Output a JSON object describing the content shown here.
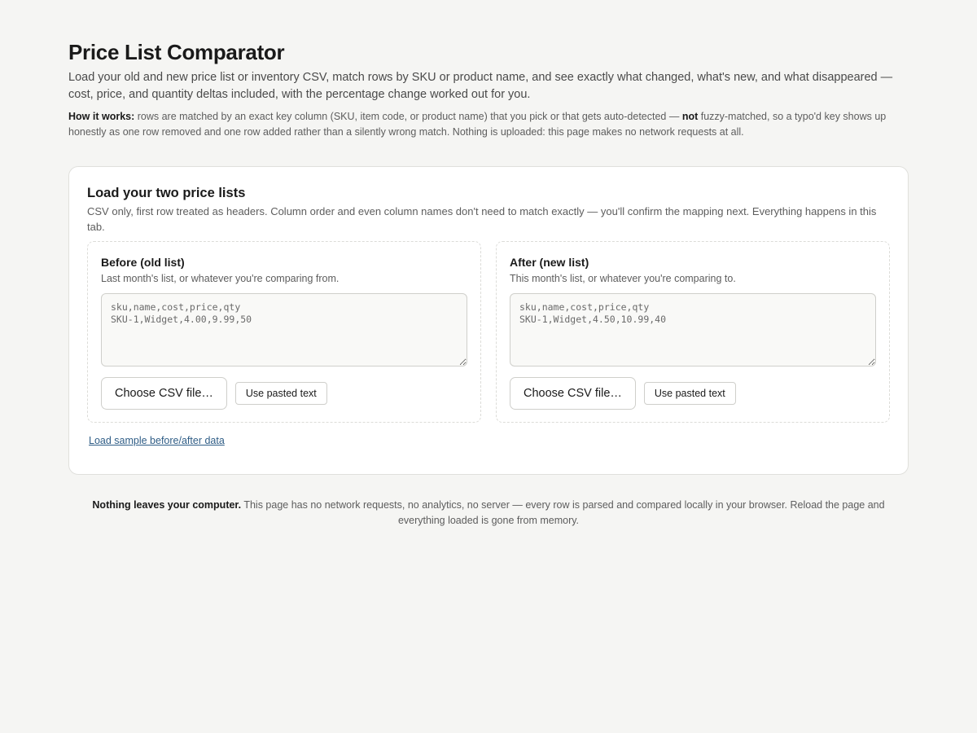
{
  "header": {
    "title": "Price List Comparator",
    "lede": "Load your old and new price list or inventory CSV, match rows by SKU or product name, and see exactly what changed, what's new, and what disappeared — cost, price, and quantity deltas included, with the percentage change worked out for you.",
    "howto_label": "How it works:",
    "howto_text_1": " rows are matched by an exact key column (SKU, item code, or product name) that you pick or that gets auto-detected — ",
    "howto_emphasis": "not",
    "howto_text_2": " fuzzy-matched, so a typo'd key shows up honestly as one row removed and one row added rather than a silently wrong match. Nothing is uploaded: this page makes no network requests at all."
  },
  "load_card": {
    "title": "Load your two price lists",
    "subtitle": "CSV only, first row treated as headers. Column order and even column names don't need to match exactly — you'll confirm the mapping next. Everything happens in this tab.",
    "before": {
      "title": "Before (old list)",
      "hint": "Last month's list, or whatever you're comparing from.",
      "placeholder": "sku,name,cost,price,qty\nSKU-1,Widget,4.00,9.99,50",
      "choose_file_label": "Choose CSV file…",
      "use_pasted_label": "Use pasted text"
    },
    "after": {
      "title": "After (new list)",
      "hint": "This month's list, or whatever you're comparing to.",
      "placeholder": "sku,name,cost,price,qty\nSKU-1,Widget,4.50,10.99,40",
      "choose_file_label": "Choose CSV file…",
      "use_pasted_label": "Use pasted text"
    },
    "sample_link_label": "Load sample before/after data"
  },
  "footer": {
    "bold": "Nothing leaves your computer.",
    "text": " This page has no network requests, no analytics, no server — every row is parsed and compared locally in your browser. Reload the page and everything loaded is gone from memory."
  }
}
